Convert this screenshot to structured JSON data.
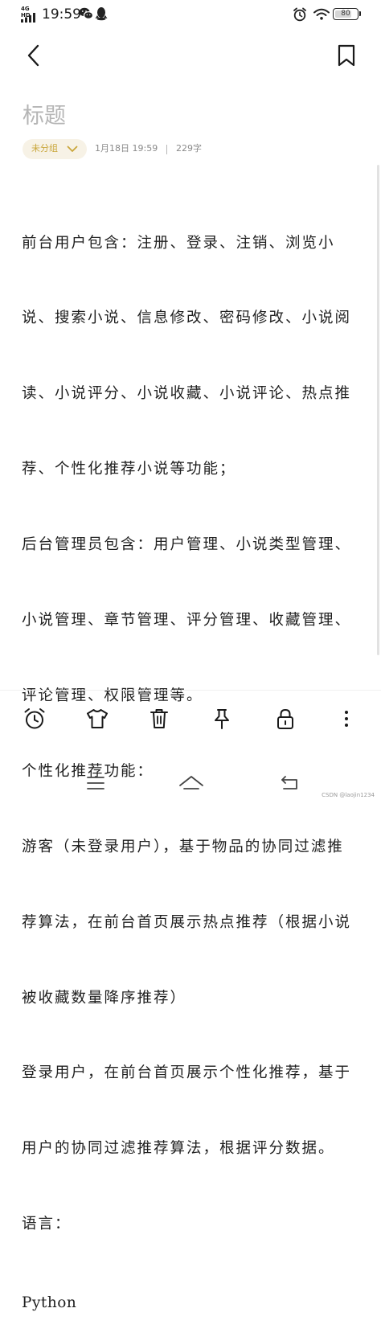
{
  "status_bar": {
    "network": "4G HD",
    "time": "19:59",
    "battery": "80",
    "battery_fraction": 0.8
  },
  "note": {
    "title_placeholder": "标题",
    "category": "未分组",
    "date": "1月18日 19:59",
    "char_count": "229字",
    "body_lines": [
      "前台用户包含：注册、登录、注销、浏览小",
      "说、搜索小说、信息修改、密码修改、小说阅",
      "读、小说评分、小说收藏、小说评论、热点推",
      "荐、个性化推荐小说等功能；",
      "后台管理员包含：用户管理、小说类型管理、",
      "小说管理、章节管理、评分管理、收藏管理、",
      "评论管理、权限管理等。",
      "个性化推荐功能：",
      "游客（未登录用户），基于物品的协同过滤推",
      "荐算法，在前台首页展示热点推荐（根据小说",
      "被收藏数量降序推荐）",
      "登录用户，在前台首页展示个性化推荐，基于",
      "用户的协同过滤推荐算法，根据评分数据。",
      "语言：",
      "Python"
    ]
  },
  "toolbar_icons": [
    "alarm-icon",
    "tshirt-icon",
    "trash-icon",
    "pin-icon",
    "lock-icon",
    "more-icon"
  ],
  "watermark": "CSDN @laojin1234",
  "colors": {
    "accent": "#c9a63a",
    "pill_bg": "#f7f2e6",
    "title_placeholder": "#b5b5b5",
    "meta": "#8a8a8a"
  }
}
